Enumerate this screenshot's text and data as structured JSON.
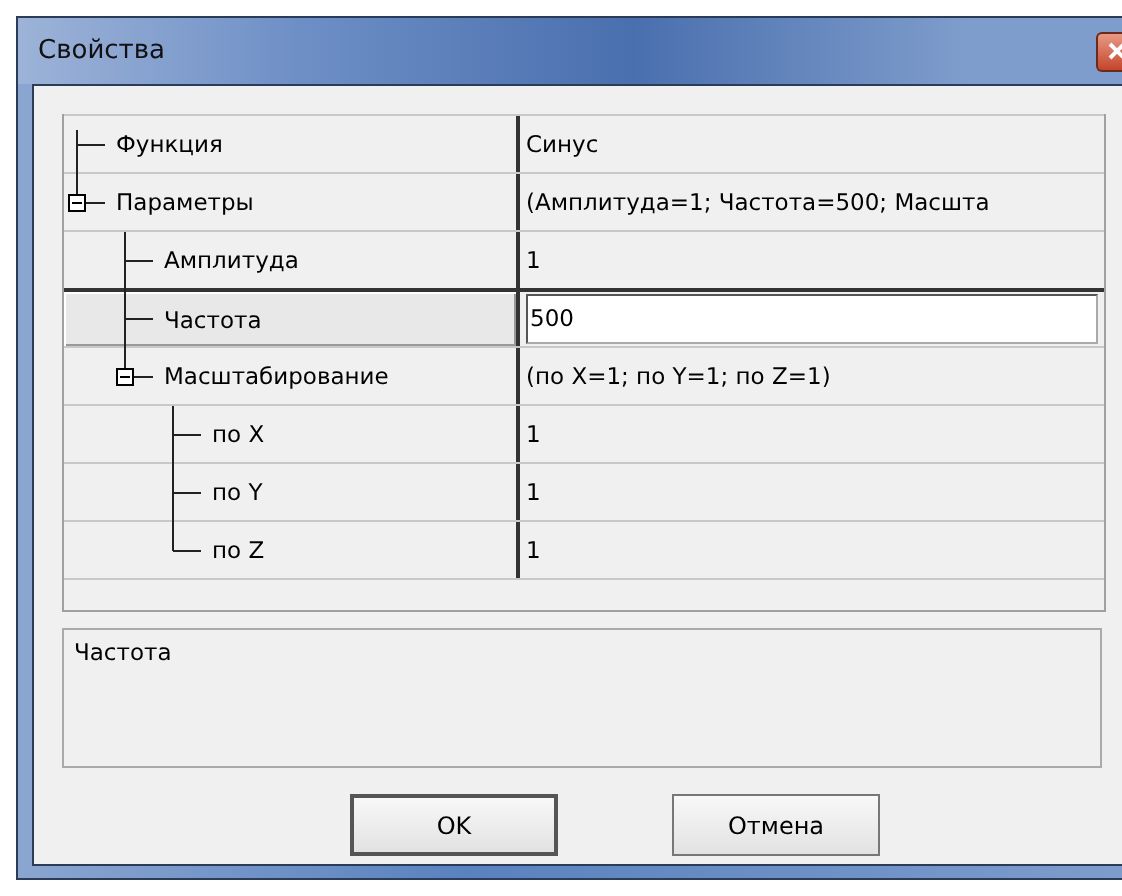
{
  "window": {
    "title": "Свойства"
  },
  "properties": [
    {
      "name": "Функция",
      "value": "Синус",
      "selected": false
    },
    {
      "name": "Параметры",
      "value": "(Амплитуда=1; Частота=500; Масшта",
      "selected": false,
      "expanded": true,
      "children": [
        {
          "name": "Амплитуда",
          "value": "1",
          "selected": false
        },
        {
          "name": "Частота",
          "value": "500",
          "selected": true
        },
        {
          "name": "Масштабирование",
          "value": "(по X=1; по Y=1; по Z=1)",
          "selected": false,
          "expanded": true,
          "children": [
            {
              "name": "по X",
              "value": "1",
              "selected": false
            },
            {
              "name": "по Y",
              "value": "1",
              "selected": false
            },
            {
              "name": "по Z",
              "value": "1",
              "selected": false
            }
          ]
        }
      ]
    }
  ],
  "description": "Частота",
  "buttons": [
    {
      "label": "OK",
      "default": true
    },
    {
      "label": "Отмена",
      "default": false
    }
  ]
}
